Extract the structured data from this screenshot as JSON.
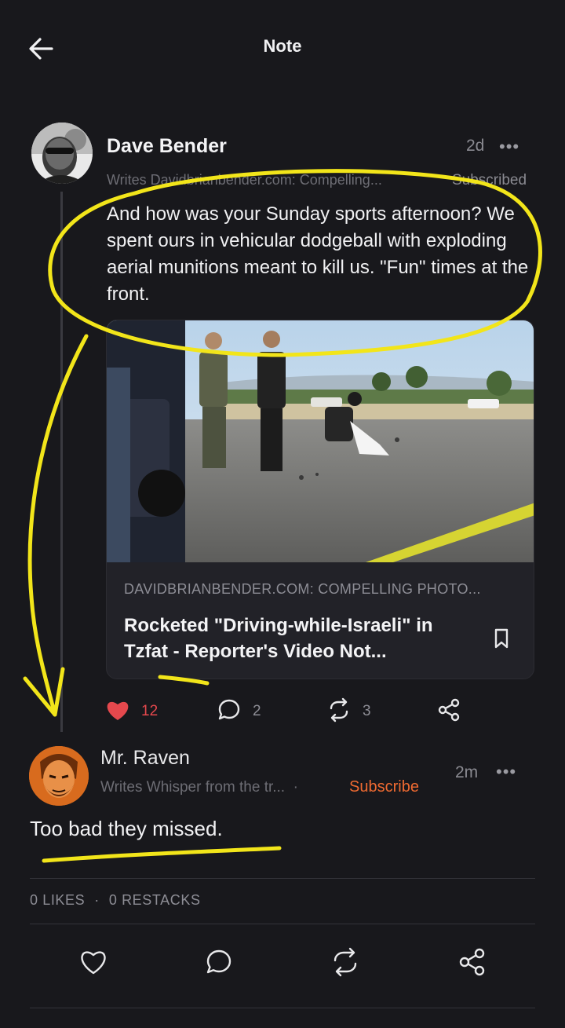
{
  "header": {
    "title": "Note"
  },
  "post": {
    "author": "Dave Bender",
    "subtitle": "Writes Davidbrianbender.com: Compelling...",
    "time": "2d",
    "more": "•••",
    "subscription_status": "Subscribed",
    "text": "And how was your Sunday sports afternoon? We spent ours in vehicular dodgeball with exploding aerial munitions meant to kill us. \"Fun\" times at the front.",
    "link_card": {
      "domain": "DAVIDBRIANBENDER.COM: COMPELLING PHOTO...",
      "title": "Rocketed \"Driving-while-Israeli\" in Tzfat - Reporter's Video Not..."
    },
    "actions": {
      "likes": "12",
      "comments": "2",
      "restacks": "3"
    }
  },
  "reply": {
    "author": "Mr. Raven",
    "subtitle": "Writes Whisper from the tr...",
    "separator": "·",
    "subscribe_label": "Subscribe",
    "time": "2m",
    "more": "•••",
    "text": "Too bad they missed.",
    "likes_label": "0 LIKES",
    "stats_separator": "·",
    "restacks_label": "0 RESTACKS"
  },
  "colors": {
    "background": "#18181c",
    "like_red": "#e5484d",
    "subscribe_orange": "#ef6a31",
    "annotation_yellow": "#f2e51a"
  },
  "icons": [
    "back-arrow-icon",
    "more-icon",
    "bookmark-icon",
    "heart-icon",
    "comment-icon",
    "restack-icon",
    "share-icon"
  ]
}
